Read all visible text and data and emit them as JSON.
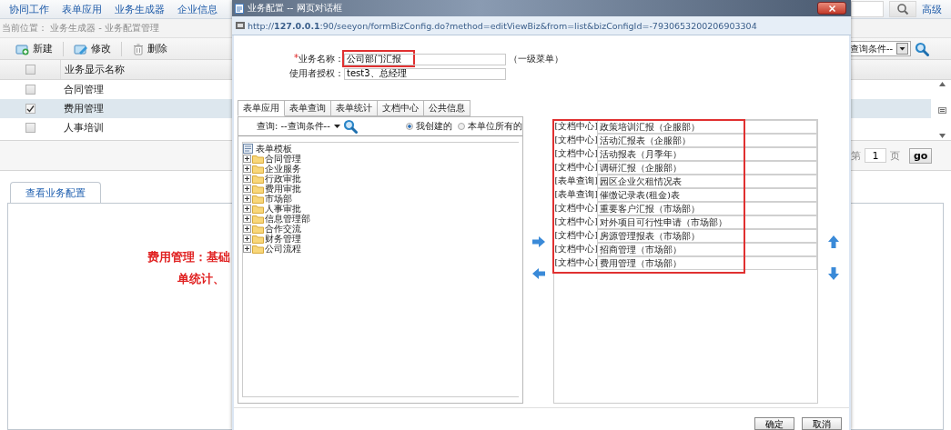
{
  "top_nav": {
    "items": [
      {
        "label": "协同工作"
      },
      {
        "label": "表单应用"
      },
      {
        "label": "业务生成器"
      },
      {
        "label": "企业信息"
      }
    ],
    "advanced_link": "高级"
  },
  "breadcrumb": "当前位置： 业务生成器 - 业务配置管理",
  "toolbar": {
    "buttons": [
      {
        "label": "新建",
        "kind": "new"
      },
      {
        "label": "修改",
        "kind": "edit"
      },
      {
        "label": "删除",
        "kind": "delete"
      }
    ],
    "query_select": "查询条件--"
  },
  "table": {
    "header_checked": false,
    "columns": [
      "业务显示名称"
    ],
    "rows": [
      {
        "name": "合同管理",
        "checked": false,
        "selected": false
      },
      {
        "name": "费用管理",
        "checked": true,
        "selected": true
      },
      {
        "name": "人事培训",
        "checked": false,
        "selected": false
      }
    ]
  },
  "pager": {
    "prefix": "第",
    "page": "1",
    "suffix": "页",
    "go": "go"
  },
  "detail": {
    "tabs": [
      {
        "label": "查看业务配置",
        "selected": true
      }
    ],
    "lines": [
      "费用管理：基础",
      "单统计、"
    ]
  },
  "dialog": {
    "title": "业务配置 -- 网页对话框",
    "url": "http://**127.0.0.1**:90/seeyon/formBizConfig.do?method=editViewBiz&from=list&bizConfigId=-7930653200206903304",
    "fields": [
      {
        "required_mark": "*",
        "label": "业务名称：",
        "value": "公司部门汇报",
        "note": "（一级菜单）",
        "highlighted": true
      },
      {
        "label": "使用者授权：",
        "value": "test3、总经理"
      }
    ],
    "tabs": [
      {
        "label": "表单应用",
        "selected": true
      },
      {
        "label": "表单查询",
        "selected": false
      },
      {
        "label": "表单统计",
        "selected": false
      },
      {
        "label": "文档中心",
        "selected": false
      },
      {
        "label": "公共信息",
        "selected": false
      }
    ],
    "query": {
      "label": "查询:",
      "select": "--查询条件--"
    },
    "scope_options": [
      {
        "label": "我创建的",
        "selected": true
      },
      {
        "label": "本单位所有的",
        "selected": false
      }
    ],
    "tree": {
      "label": "表单模板",
      "children": [
        {
          "label": "合同管理",
          "expanded": false
        },
        {
          "label": "企业服务",
          "expanded": false
        },
        {
          "label": "行政审批",
          "expanded": false
        },
        {
          "label": "费用审批",
          "expanded": false
        },
        {
          "label": "市场部",
          "expanded": false
        },
        {
          "label": "人事审批",
          "expanded": false
        },
        {
          "label": "信息管理部",
          "expanded": false
        },
        {
          "label": "合作交流",
          "expanded": false
        },
        {
          "label": "财务管理",
          "expanded": false
        },
        {
          "label": "公司流程",
          "expanded": false
        }
      ]
    },
    "selected_list": {
      "highlighted": true,
      "items": [
        {
          "category": "[文档中心]",
          "name": "政策培训汇报（企服部）"
        },
        {
          "category": "[文档中心]",
          "name": "活动汇报表（企服部）"
        },
        {
          "category": "[文档中心]",
          "name": "活动报表（月季年）"
        },
        {
          "category": "[文档中心]",
          "name": "调研汇报（企服部）"
        },
        {
          "category": "[表单查询]",
          "name": "园区企业欠租情况表"
        },
        {
          "category": "[表单查询]",
          "name": "催缴记录表(租金)表"
        },
        {
          "category": "[文档中心]",
          "name": "重要客户汇报（市场部）"
        },
        {
          "category": "[文档中心]",
          "name": "对外项目可行性申请（市场部）"
        },
        {
          "category": "[文档中心]",
          "name": "房源管理报表（市场部）"
        },
        {
          "category": "[文档中心]",
          "name": "招商管理（市场部）"
        },
        {
          "category": "[文档中心]",
          "name": "费用管理（市场部）"
        }
      ]
    },
    "buttons": [
      "确定",
      "取消"
    ]
  }
}
